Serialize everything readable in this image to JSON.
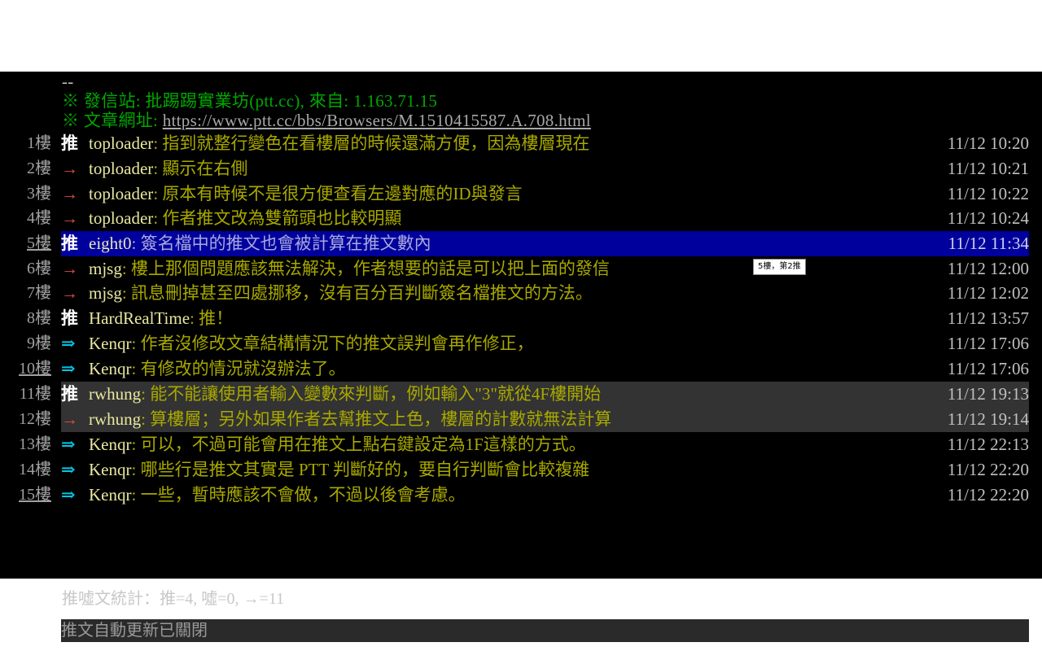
{
  "header": {
    "dashes": "--",
    "line1": "※ 發信站: 批踢踢實業坊(ptt.cc), 來自: 1.163.71.15",
    "line2_label": "※ 文章網址: ",
    "line2_url": "https://www.ptt.cc/bbs/Browsers/M.1510415587.A.708.html"
  },
  "colors": {
    "push": "#ffffff",
    "arrow": "#e04848",
    "reply": "#00c8e8",
    "message": "#a8a800",
    "user": "#e8e8a0",
    "selected_bg": "#00009c"
  },
  "comments": [
    {
      "floor": "1樓",
      "tag": "推",
      "user": "toploader",
      "text": ": 指到就整行變色在看樓層的時候還滿方便，因為樓層現在",
      "time": "11/12 10:20"
    },
    {
      "floor": "2樓",
      "tag": "→",
      "user": "toploader",
      "text": ": 顯示在右側",
      "time": "11/12 10:21"
    },
    {
      "floor": "3樓",
      "tag": "→",
      "user": "toploader",
      "text": ": 原本有時候不是很方便查看左邊對應的ID與發言",
      "time": "11/12 10:22"
    },
    {
      "floor": "4樓",
      "tag": "→",
      "user": "toploader",
      "text": ": 作者推文改為雙箭頭也比較明顯",
      "time": "11/12 10:24"
    },
    {
      "floor": "5樓",
      "tag": "推",
      "user": "eight0",
      "text": ": 簽名檔中的推文也會被計算在推文數內",
      "time": "11/12 11:34"
    },
    {
      "floor": "6樓",
      "tag": "→",
      "user": "mjsg",
      "text": ": 樓上那個問題應該無法解決，作者想要的話是可以把上面的發信",
      "time": "11/12 12:00"
    },
    {
      "floor": "7樓",
      "tag": "→",
      "user": "mjsg",
      "text": ": 訊息刪掉甚至四處挪移，沒有百分百判斷簽名檔推文的方法。",
      "time": "11/12 12:02"
    },
    {
      "floor": "8樓",
      "tag": "推",
      "user": "HardRealTime",
      "text": ": 推！",
      "time": "11/12 13:57"
    },
    {
      "floor": "9樓",
      "tag": "⇒",
      "user": "Kenqr",
      "text": ": 作者沒修改文章結構情況下的推文誤判會再作修正，",
      "time": "11/12 17:06"
    },
    {
      "floor": "10樓",
      "tag": "⇒",
      "user": "Kenqr",
      "text": ": 有修改的情況就沒辦法了。",
      "time": "11/12 17:06"
    },
    {
      "floor": "11樓",
      "tag": "推",
      "user": "rwhung",
      "text": ": 能不能讓使用者輸入變數來判斷，例如輸入\"3\"就從4F樓開始",
      "time": "11/12 19:13"
    },
    {
      "floor": "12樓",
      "tag": "→",
      "user": "rwhung",
      "text": ": 算樓層；另外如果作者去幫推文上色，樓層的計數就無法計算",
      "time": "11/12 19:14"
    },
    {
      "floor": "13樓",
      "tag": "⇒",
      "user": "Kenqr",
      "text": ": 可以，不過可能會用在推文上點右鍵設定為1F這樣的方式。",
      "time": "11/12 22:13"
    },
    {
      "floor": "14樓",
      "tag": "⇒",
      "user": "Kenqr",
      "text": ": 哪些行是推文其實是 PTT 判斷好的，要自行判斷會比較複雜",
      "time": "11/12 22:20"
    },
    {
      "floor": "15樓",
      "tag": "⇒",
      "user": "Kenqr",
      "text": ": 一些，暫時應該不會做，不過以後會考慮。",
      "time": "11/12 22:20"
    }
  ],
  "tooltip": "5樓，第2推",
  "stats": "推噓文統計：推=4, 噓=0, →=11",
  "status_bar": "推文自動更新已關閉"
}
